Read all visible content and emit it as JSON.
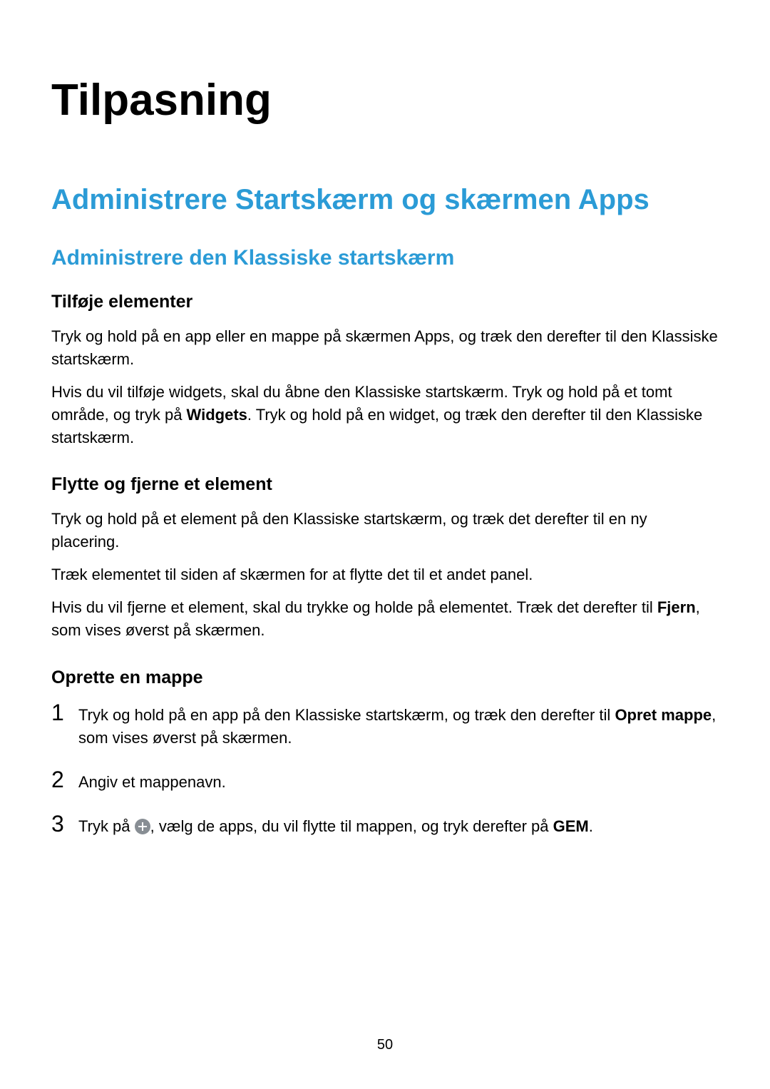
{
  "title": "Tilpasning",
  "section": "Administrere Startskærm og skærmen Apps",
  "subsection": "Administrere den Klassiske startskærm",
  "b1": {
    "heading": "Tilføje elementer",
    "p1": "Tryk og hold på en app eller en mappe på skærmen Apps, og træk den derefter til den Klassiske startskærm.",
    "p2a": "Hvis du vil tilføje widgets, skal du åbne den Klassiske startskærm. Tryk og hold på et tomt område, og tryk på ",
    "p2bold": "Widgets",
    "p2b": ". Tryk og hold på en widget, og træk den derefter til den Klassiske startskærm."
  },
  "b2": {
    "heading": "Flytte og fjerne et element",
    "p1": "Tryk og hold på et element på den Klassiske startskærm, og træk det derefter til en ny placering.",
    "p2": "Træk elementet til siden af skærmen for at flytte det til et andet panel.",
    "p3a": "Hvis du vil fjerne et element, skal du trykke og holde på elementet. Træk det derefter til ",
    "p3bold": "Fjern",
    "p3b": ", som vises øverst på skærmen."
  },
  "b3": {
    "heading": "Oprette en mappe",
    "step1a": "Tryk og hold på en app på den Klassiske startskærm, og træk den derefter til ",
    "step1bold": "Opret mappe",
    "step1b": ", som vises øverst på skærmen.",
    "step2": "Angiv et mappenavn.",
    "step3a": "Tryk på ",
    "step3b": ", vælg de apps, du vil flytte til mappen, og tryk derefter på ",
    "step3bold": "GEM",
    "step3c": ".",
    "n1": "1",
    "n2": "2",
    "n3": "3"
  },
  "pagenum": "50"
}
